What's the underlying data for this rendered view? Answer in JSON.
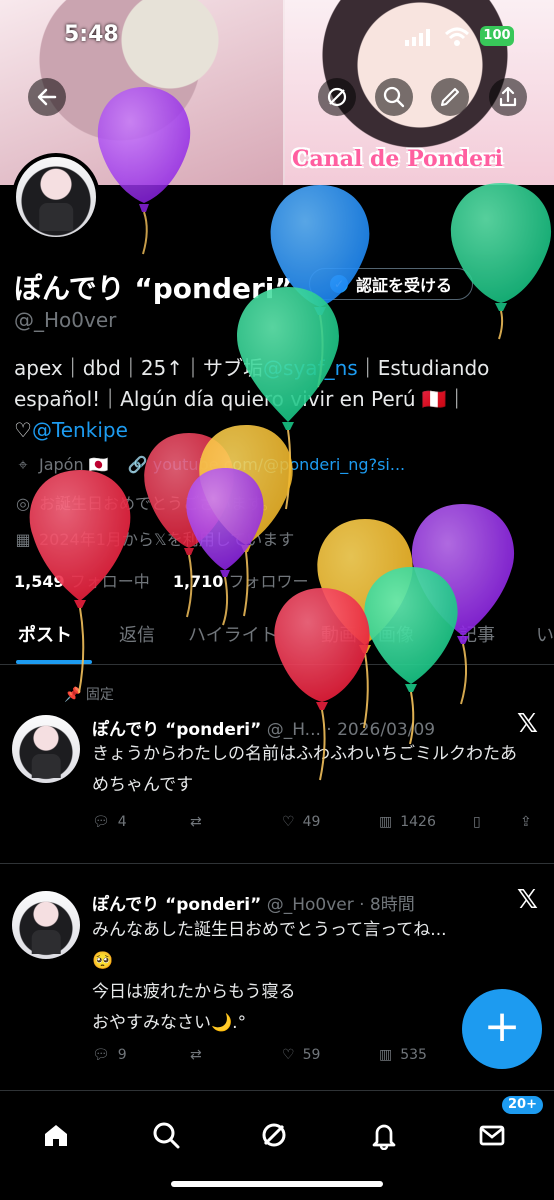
{
  "status_bar": {
    "time": "5:48",
    "battery": "100"
  },
  "banner": {
    "overlay_text": "Canal de Ponderi"
  },
  "header_actions": {
    "back_icon": "arrow-left-icon",
    "grok_icon": "slashed-circle-icon",
    "search_icon": "search-icon",
    "edit_icon": "pen-icon",
    "share_icon": "share-icon"
  },
  "profile": {
    "display_name": "ぽんでり “ponderi”",
    "verify_label": "認証を受ける",
    "handle": "@_Ho0ver",
    "bio_segments": {
      "part1": "apex｜dbd｜25↑｜サブ垢",
      "mention1": "@syaf_ns",
      "part2": "｜Estudiando",
      "part3": "español!｜Algún día quiero vivir en Perú 🇵🇪｜",
      "heart": "♡",
      "mention2": "@Tenkipe"
    },
    "location": "Japón 🇯🇵",
    "website": "youtube.com/@ponderi_ng?si...",
    "birthday": "お誕生日おめでとうございます。",
    "joined": "2024年1月から𝕏を利用しています",
    "following_count": "1,549",
    "following_label": "フォロー中",
    "followers_count": "1,710",
    "followers_label": "フォロワー"
  },
  "tabs": [
    "ポスト",
    "返信",
    "ハイライト",
    "動画",
    "画像",
    "記事",
    "い"
  ],
  "pinned_label": "固定",
  "posts": [
    {
      "name": "ぽんでり “ponderi”",
      "handle_time": "@_H... · 2026/03/09",
      "text": "きょうからわたしの名前はふわふわいちごミルクわたあめちゃんです",
      "replies": "4",
      "reposts": "",
      "likes": "49",
      "views": "1426"
    },
    {
      "name": "ぽんでり “ponderi”",
      "handle_time": "@_Ho0ver · 8時間",
      "text": "みんなあした誕生日おめでとうって言ってね...\n🥺\n今日は疲れたからもう寝る\nおやすみなさい🌙.°",
      "replies": "9",
      "reposts": "",
      "likes": "59",
      "views": "535"
    }
  ],
  "fab": {
    "label": "+"
  },
  "bottom_nav": {
    "items": [
      "home-icon",
      "search-icon",
      "grok-icon",
      "notifications-icon",
      "messages-icon"
    ],
    "messages_badge": "20+"
  },
  "colors": {
    "accent": "#1d9bf0",
    "background": "#000000",
    "secondary_text": "#71767b",
    "balloon_purple": "#8f24e8",
    "balloon_blue": "#1c86f2",
    "balloon_green": "#19c384",
    "balloon_red": "#e8203c",
    "balloon_yellow": "#f1b628"
  }
}
